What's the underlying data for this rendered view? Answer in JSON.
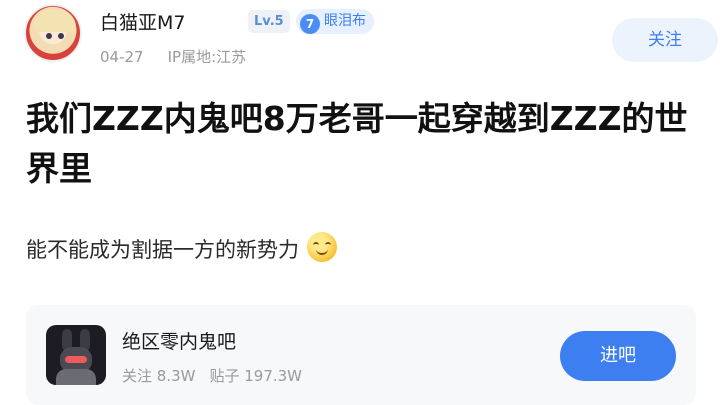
{
  "author": {
    "name": "白猫亚M7",
    "level_badge": "Lv.5",
    "fan_badge": "眼泪布",
    "date": "04-27",
    "ip_location": "IP属地:江苏"
  },
  "follow_label": "关注",
  "post": {
    "title": "我们ZZZ内鬼吧8万老哥一起穿越到ZZZ的世界里",
    "body": "能不能成为割据一方的新势力"
  },
  "forum": {
    "name": "绝区零内鬼吧",
    "followers": "关注 8.3W",
    "posts": "贴子 197.3W",
    "enter_label": "进吧"
  },
  "icons": {
    "fan_badge": "gem-icon",
    "emoji": "smile-emoji-icon"
  },
  "colors": {
    "accent": "#3d7ff0",
    "muted_text": "#9a9a9a",
    "card_bg": "#f7f8fa"
  }
}
